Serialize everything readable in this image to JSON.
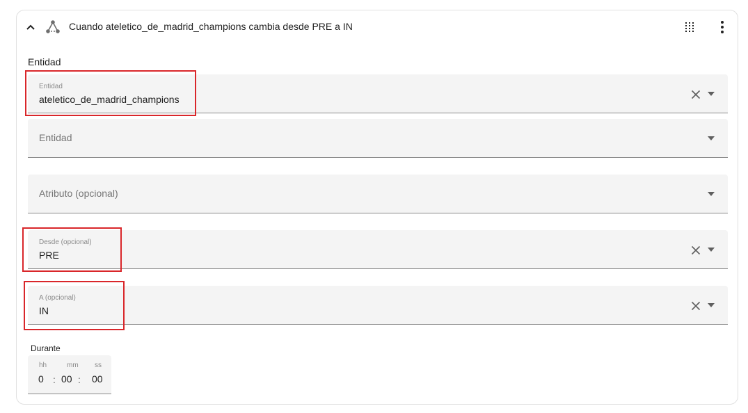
{
  "header": {
    "title": "Cuando ateletico_de_madrid_champions cambia desde PRE a IN",
    "icons": [
      "chevron-up-icon",
      "state-trigger-icon",
      "drag-handle-icon",
      "more-vertical-icon"
    ]
  },
  "section": {
    "label": "Entidad"
  },
  "fields": {
    "entity": {
      "label": "Entidad",
      "value": "ateletico_de_madrid_champions"
    },
    "entity_add": {
      "placeholder": "Entidad"
    },
    "attribute": {
      "placeholder": "Atributo (opcional)"
    },
    "from": {
      "label": "Desde (opcional)",
      "value": "PRE"
    },
    "to": {
      "label": "A (opcional)",
      "value": "IN"
    }
  },
  "duration": {
    "label": "Durante",
    "hh_label": "hh",
    "mm_label": "mm",
    "ss_label": "ss",
    "hh": "0",
    "mm": "00",
    "ss": "00",
    "separator": ":"
  },
  "colors": {
    "highlight": "#d9262a",
    "field_bg": "#f4f4f4",
    "icon": "#5f5f5f"
  }
}
